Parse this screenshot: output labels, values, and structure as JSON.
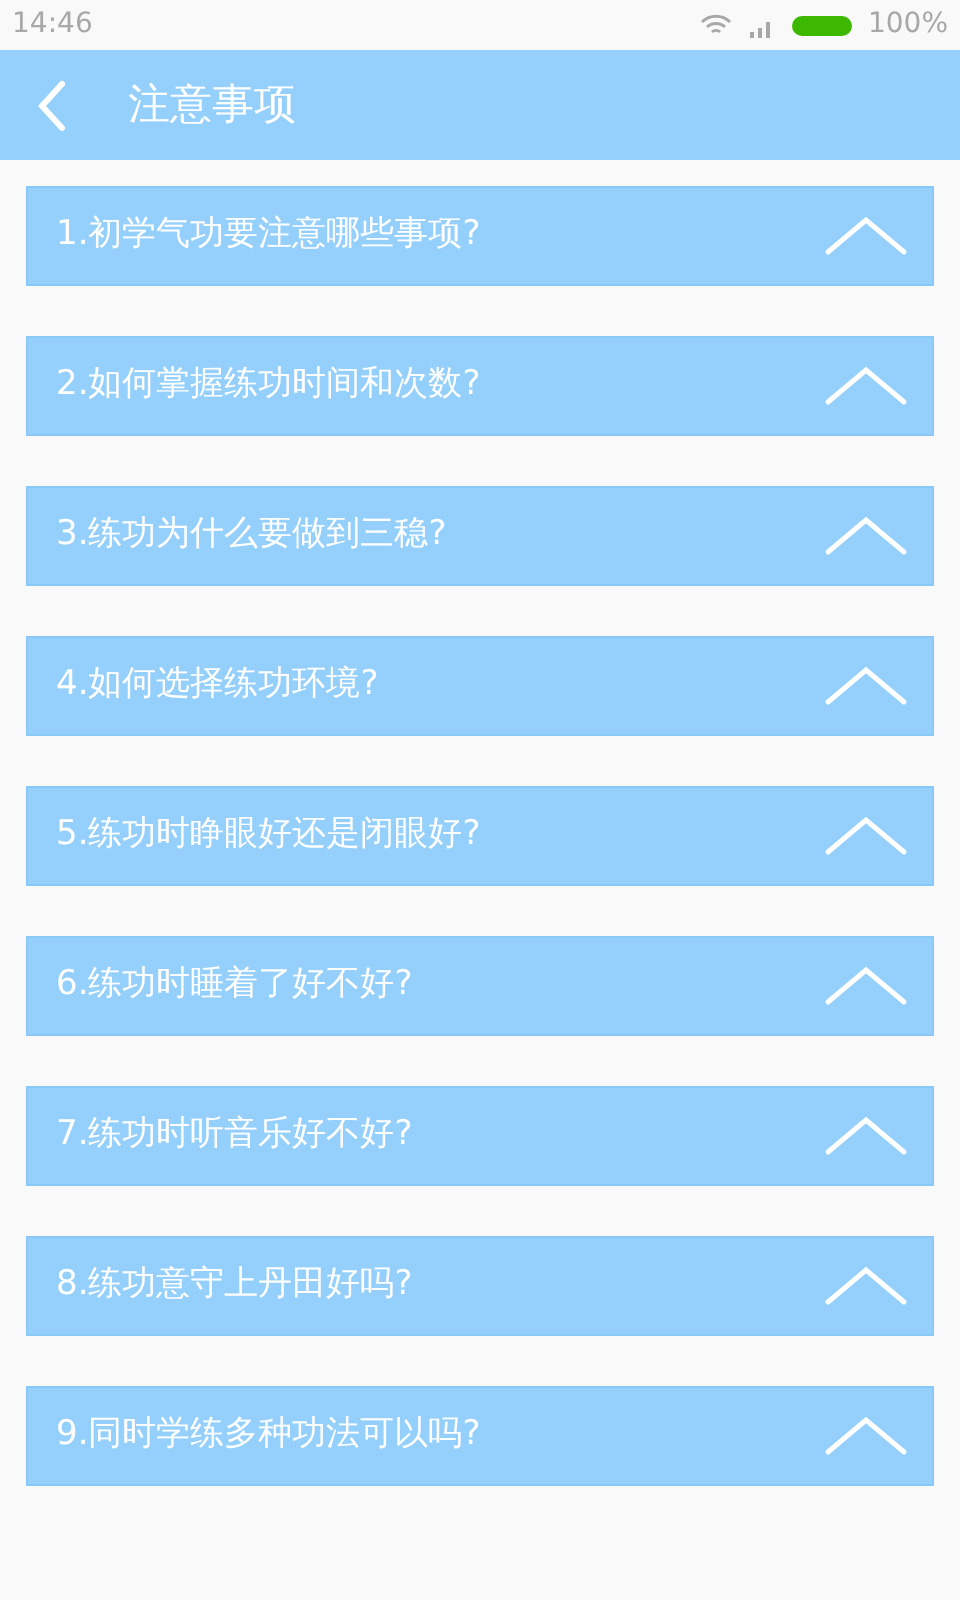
{
  "status_bar": {
    "time": "14:46",
    "battery_text": "100%"
  },
  "header": {
    "title": "注意事项"
  },
  "items": [
    {
      "label": "1.初学气功要注意哪些事项?"
    },
    {
      "label": "2.如何掌握练功时间和次数?"
    },
    {
      "label": "3.练功为什么要做到三稳?"
    },
    {
      "label": "4.如何选择练功环境?"
    },
    {
      "label": "5.练功时睁眼好还是闭眼好?"
    },
    {
      "label": "6.练功时睡着了好不好?"
    },
    {
      "label": "7.练功时听音乐好不好?"
    },
    {
      "label": "8.练功意守上丹田好吗?"
    },
    {
      "label": "9.同时学练多种功法可以吗?"
    }
  ]
}
